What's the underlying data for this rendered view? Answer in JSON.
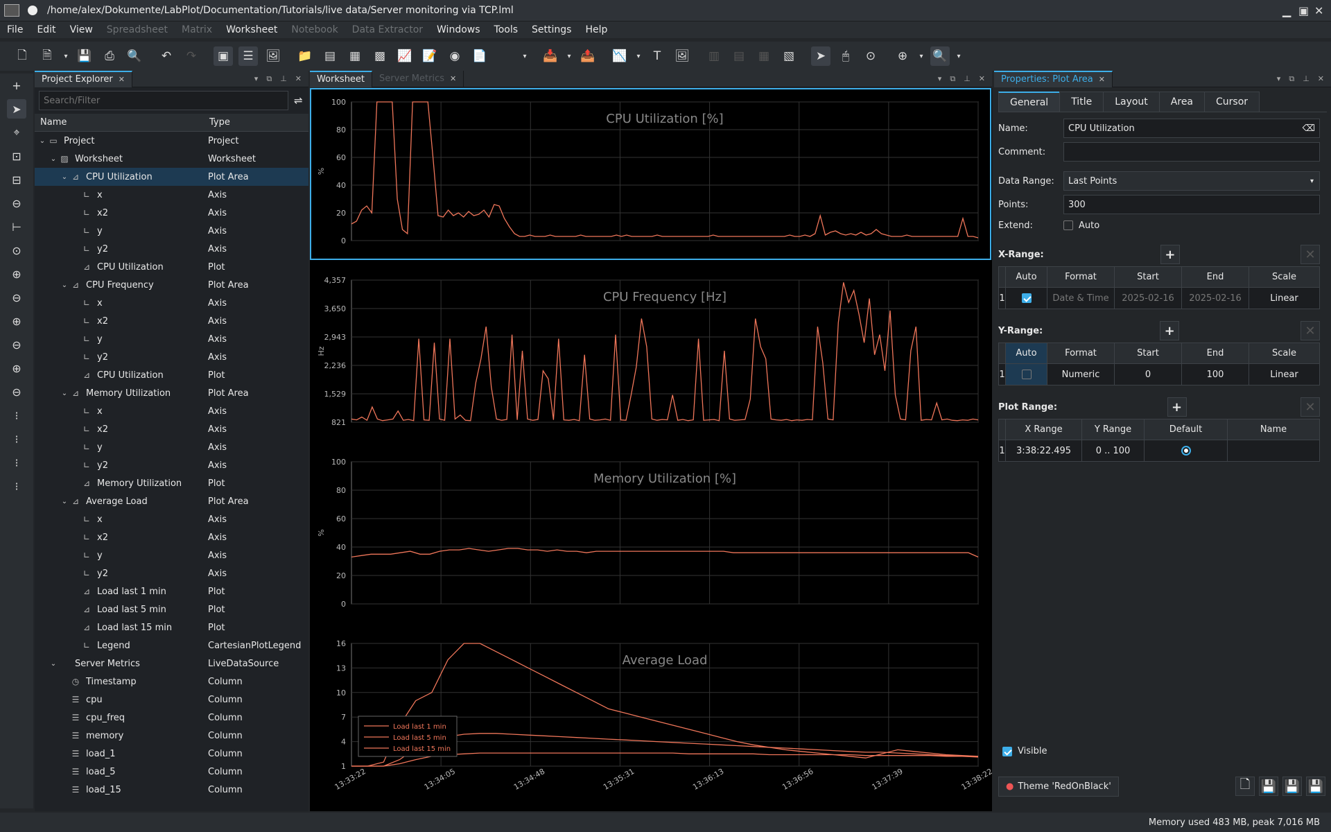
{
  "window": {
    "title": "/home/alex/Dokumente/LabPlot/Documentation/Tutorials/live data/Server monitoring via TCP.lml"
  },
  "menu": [
    "File",
    "Edit",
    "View",
    "Spreadsheet",
    "Matrix",
    "Worksheet",
    "Notebook",
    "Data Extractor",
    "Windows",
    "Tools",
    "Settings",
    "Help"
  ],
  "menu_disabled": [
    false,
    false,
    false,
    true,
    true,
    false,
    true,
    true,
    false,
    false,
    false,
    false
  ],
  "project_explorer": {
    "tab": "Project Explorer",
    "search_placeholder": "Search/Filter",
    "col_name": "Name",
    "col_type": "Type",
    "rows": [
      {
        "name": "Project",
        "type": "Project",
        "level": 0,
        "icon": "folder",
        "exp": "v"
      },
      {
        "name": "Worksheet",
        "type": "Worksheet",
        "level": 1,
        "icon": "worksheet",
        "exp": "v"
      },
      {
        "name": "CPU Utilization",
        "type": "Plot Area",
        "level": 2,
        "icon": "plotarea",
        "exp": "v",
        "sel": true
      },
      {
        "name": "x",
        "type": "Axis",
        "level": 3,
        "icon": "axis"
      },
      {
        "name": "x2",
        "type": "Axis",
        "level": 3,
        "icon": "axis"
      },
      {
        "name": "y",
        "type": "Axis",
        "level": 3,
        "icon": "axis"
      },
      {
        "name": "y2",
        "type": "Axis",
        "level": 3,
        "icon": "axis"
      },
      {
        "name": "CPU Utilization",
        "type": "Plot",
        "level": 3,
        "icon": "plot"
      },
      {
        "name": "CPU Frequency",
        "type": "Plot Area",
        "level": 2,
        "icon": "plotarea",
        "exp": "v"
      },
      {
        "name": "x",
        "type": "Axis",
        "level": 3,
        "icon": "axis"
      },
      {
        "name": "x2",
        "type": "Axis",
        "level": 3,
        "icon": "axis"
      },
      {
        "name": "y",
        "type": "Axis",
        "level": 3,
        "icon": "axis"
      },
      {
        "name": "y2",
        "type": "Axis",
        "level": 3,
        "icon": "axis"
      },
      {
        "name": "CPU Utilization",
        "type": "Plot",
        "level": 3,
        "icon": "plot"
      },
      {
        "name": "Memory Utilization",
        "type": "Plot Area",
        "level": 2,
        "icon": "plotarea",
        "exp": "v"
      },
      {
        "name": "x",
        "type": "Axis",
        "level": 3,
        "icon": "axis"
      },
      {
        "name": "x2",
        "type": "Axis",
        "level": 3,
        "icon": "axis"
      },
      {
        "name": "y",
        "type": "Axis",
        "level": 3,
        "icon": "axis"
      },
      {
        "name": "y2",
        "type": "Axis",
        "level": 3,
        "icon": "axis"
      },
      {
        "name": "Memory Utilization",
        "type": "Plot",
        "level": 3,
        "icon": "plot"
      },
      {
        "name": "Average Load",
        "type": "Plot Area",
        "level": 2,
        "icon": "plotarea",
        "exp": "v"
      },
      {
        "name": "x",
        "type": "Axis",
        "level": 3,
        "icon": "axis"
      },
      {
        "name": "x2",
        "type": "Axis",
        "level": 3,
        "icon": "axis"
      },
      {
        "name": "y",
        "type": "Axis",
        "level": 3,
        "icon": "axis"
      },
      {
        "name": "y2",
        "type": "Axis",
        "level": 3,
        "icon": "axis"
      },
      {
        "name": "Load last 1 min",
        "type": "Plot",
        "level": 3,
        "icon": "plot"
      },
      {
        "name": "Load last 5 min",
        "type": "Plot",
        "level": 3,
        "icon": "plot"
      },
      {
        "name": "Load last 15 min",
        "type": "Plot",
        "level": 3,
        "icon": "plot"
      },
      {
        "name": "Legend",
        "type": "CartesianPlotLegend",
        "level": 3,
        "icon": "axis"
      },
      {
        "name": "Server Metrics",
        "type": "LiveDataSource",
        "level": 1,
        "icon": "none",
        "exp": "v"
      },
      {
        "name": "Timestamp",
        "type": "Column",
        "level": 2,
        "icon": "clock"
      },
      {
        "name": "cpu",
        "type": "Column",
        "level": 2,
        "icon": "column"
      },
      {
        "name": "cpu_freq",
        "type": "Column",
        "level": 2,
        "icon": "column"
      },
      {
        "name": "memory",
        "type": "Column",
        "level": 2,
        "icon": "column"
      },
      {
        "name": "load_1",
        "type": "Column",
        "level": 2,
        "icon": "column"
      },
      {
        "name": "load_5",
        "type": "Column",
        "level": 2,
        "icon": "column"
      },
      {
        "name": "load_15",
        "type": "Column",
        "level": 2,
        "icon": "column"
      }
    ]
  },
  "center_tabs": [
    "Worksheet",
    "Server Metrics"
  ],
  "chart_data": [
    {
      "type": "line",
      "title": "CPU Utilization [%]",
      "ylabel": "%",
      "ylim": [
        0,
        100
      ],
      "yticks": [
        "100",
        "80",
        "60",
        "40",
        "20",
        "0"
      ],
      "series": [
        {
          "name": "CPU Utilization",
          "values": [
            12,
            14,
            22,
            25,
            20,
            100,
            100,
            100,
            100,
            30,
            8,
            5,
            100,
            100,
            100,
            100,
            60,
            18,
            17,
            22,
            18,
            20,
            17,
            21,
            18,
            19,
            22,
            17,
            26,
            25,
            16,
            10,
            5,
            3,
            3,
            4,
            3,
            3,
            3,
            4,
            3,
            3,
            3,
            3,
            3,
            4,
            3,
            3,
            3,
            3,
            3,
            3,
            4,
            3,
            4,
            3,
            3,
            3,
            3,
            3,
            4,
            3,
            3,
            3,
            3,
            3,
            3,
            3,
            3,
            3,
            3,
            4,
            3,
            3,
            3,
            3,
            3,
            3,
            3,
            3,
            3,
            3,
            3,
            3,
            3,
            3,
            4,
            3,
            3,
            4,
            3,
            5,
            18,
            4,
            6,
            7,
            5,
            4,
            5,
            4,
            6,
            4,
            5,
            8,
            5,
            4,
            3,
            3,
            3,
            4,
            3,
            3,
            3,
            3,
            3,
            3,
            3,
            3,
            3,
            3,
            16,
            3,
            3,
            2
          ]
        }
      ]
    },
    {
      "type": "line",
      "title": "CPU Frequency [Hz]",
      "ylabel": "Hz",
      "ylim": [
        821,
        4357
      ],
      "yticks": [
        "4,357",
        "3,650",
        "2,943",
        "2,236",
        "1,529",
        "821"
      ],
      "series": [
        {
          "name": "CPU Utilization",
          "values": [
            900,
            880,
            950,
            870,
            1200,
            900,
            860,
            880,
            900,
            1100,
            870,
            890,
            860,
            2900,
            880,
            870,
            2800,
            900,
            870,
            2900,
            900,
            1000,
            870,
            860,
            1800,
            2400,
            3200,
            1700,
            900,
            870,
            890,
            3000,
            880,
            2600,
            900,
            870,
            890,
            2100,
            1900,
            880,
            2900,
            880,
            870,
            890,
            860,
            2500,
            900,
            870,
            880,
            900,
            870,
            3000,
            880,
            870,
            1500,
            2200,
            3400,
            2700,
            900,
            870,
            890,
            880,
            1500,
            870,
            890,
            860,
            880,
            2900,
            870,
            880,
            890,
            860,
            2600,
            900,
            870,
            880,
            890,
            1400,
            3400,
            2700,
            2400,
            900,
            880,
            870,
            890,
            860,
            880,
            870,
            890,
            880,
            3200,
            2300,
            900,
            880,
            3300,
            4300,
            3800,
            4100,
            3500,
            2800,
            3900,
            2500,
            3000,
            2100,
            3600,
            1500,
            900,
            880,
            2600,
            3200,
            870,
            890,
            880,
            1300,
            880,
            900,
            870,
            860,
            880,
            870,
            900,
            880
          ]
        }
      ]
    },
    {
      "type": "line",
      "title": "Memory Utilization [%]",
      "ylabel": "%",
      "ylim": [
        0,
        100
      ],
      "yticks": [
        "100",
        "80",
        "60",
        "40",
        "20",
        "0"
      ],
      "series": [
        {
          "name": "Memory Utilization",
          "values": [
            33,
            34,
            35,
            35,
            35,
            36,
            37,
            35,
            35,
            37,
            38,
            38,
            39,
            38,
            37,
            38,
            39,
            39,
            38,
            38,
            37,
            38,
            37,
            37,
            36,
            37,
            37,
            37,
            37,
            37,
            37,
            37,
            37,
            37,
            37,
            37,
            37,
            37,
            37,
            36,
            36,
            36,
            36,
            36,
            36,
            36,
            36,
            36,
            36,
            36,
            36,
            36,
            36,
            36,
            36,
            36,
            36,
            36,
            36,
            36,
            36,
            36,
            36,
            36,
            33
          ]
        }
      ]
    },
    {
      "type": "line",
      "title": "Average Load",
      "ylim": [
        1,
        16
      ],
      "yticks": [
        "16",
        "13",
        "10",
        "7",
        "4",
        "1"
      ],
      "xticks": [
        "13:33:22",
        "13:34:05",
        "13:34:48",
        "13:35:31",
        "13:36:13",
        "13:36:56",
        "13:37:39",
        "13:38:22"
      ],
      "series": [
        {
          "name": "Load last 1 min",
          "values": [
            1,
            1,
            1.5,
            6,
            9,
            10,
            14,
            17,
            16,
            15,
            14,
            13,
            12,
            11,
            10,
            9,
            8,
            7.5,
            7,
            6.5,
            6,
            5.5,
            5,
            4.5,
            4,
            3.6,
            3.3,
            3,
            2.8,
            2.6,
            2.4,
            2.2,
            2,
            2.5,
            3,
            2.8,
            2.6,
            2.4,
            2.3,
            2.2
          ]
        },
        {
          "name": "Load last 5 min",
          "values": [
            1,
            1,
            1,
            1.8,
            3.2,
            4.2,
            4.6,
            4.9,
            5,
            5,
            4.9,
            4.8,
            4.7,
            4.6,
            4.5,
            4.4,
            4.3,
            4.2,
            4.1,
            4,
            3.9,
            3.8,
            3.7,
            3.6,
            3.5,
            3.4,
            3.3,
            3.2,
            3.1,
            3,
            2.9,
            2.8,
            2.7,
            2.7,
            2.6,
            2.5,
            2.4,
            2.3,
            2.2,
            2.1
          ]
        },
        {
          "name": "Load last 15 min",
          "values": [
            1,
            1,
            1,
            1.3,
            1.8,
            2.2,
            2.4,
            2.5,
            2.6,
            2.6,
            2.6,
            2.6,
            2.6,
            2.6,
            2.6,
            2.6,
            2.6,
            2.6,
            2.6,
            2.6,
            2.6,
            2.5,
            2.5,
            2.5,
            2.5,
            2.5,
            2.4,
            2.4,
            2.4,
            2.4,
            2.4,
            2.4,
            2.3,
            2.3,
            2.3,
            2.3,
            2.3,
            2.2,
            2.2,
            2.2
          ]
        }
      ],
      "legend": "bottom-left"
    }
  ],
  "properties": {
    "tab": "Properties: Plot Area",
    "tabs": [
      "General",
      "Title",
      "Layout",
      "Area",
      "Cursor"
    ],
    "name_label": "Name:",
    "name_value": "CPU Utilization",
    "comment_label": "Comment:",
    "datarange_label": "Data Range:",
    "datarange_value": "Last Points",
    "points_label": "Points:",
    "points_value": "300",
    "extend_label": "Extend:",
    "extend_value": "Auto",
    "xrange_label": "X-Range:",
    "yrange_label": "Y-Range:",
    "plotrange_label": "Plot Range:",
    "range_headers": [
      "Auto",
      "Format",
      "Start",
      "End",
      "Scale"
    ],
    "xrange_row": {
      "idx": "1",
      "format": "Date & Time",
      "start": "2025-02-16",
      "end": "2025-02-16",
      "scale": "Linear"
    },
    "yrange_row": {
      "idx": "1",
      "format": "Numeric",
      "start": "0",
      "end": "100",
      "scale": "Linear"
    },
    "plotrange_headers": [
      "X Range",
      "Y Range",
      "Default",
      "Name"
    ],
    "plotrange_row": {
      "idx": "1",
      "x": "3:38:22.495",
      "y": "0 .. 100"
    },
    "visible_label": "Visible",
    "theme": "Theme 'RedOnBlack'"
  },
  "status": "Memory used 483 MB, peak 7,016 MB",
  "colors": {
    "line": "#f0765a",
    "accent": "#3daee9"
  }
}
